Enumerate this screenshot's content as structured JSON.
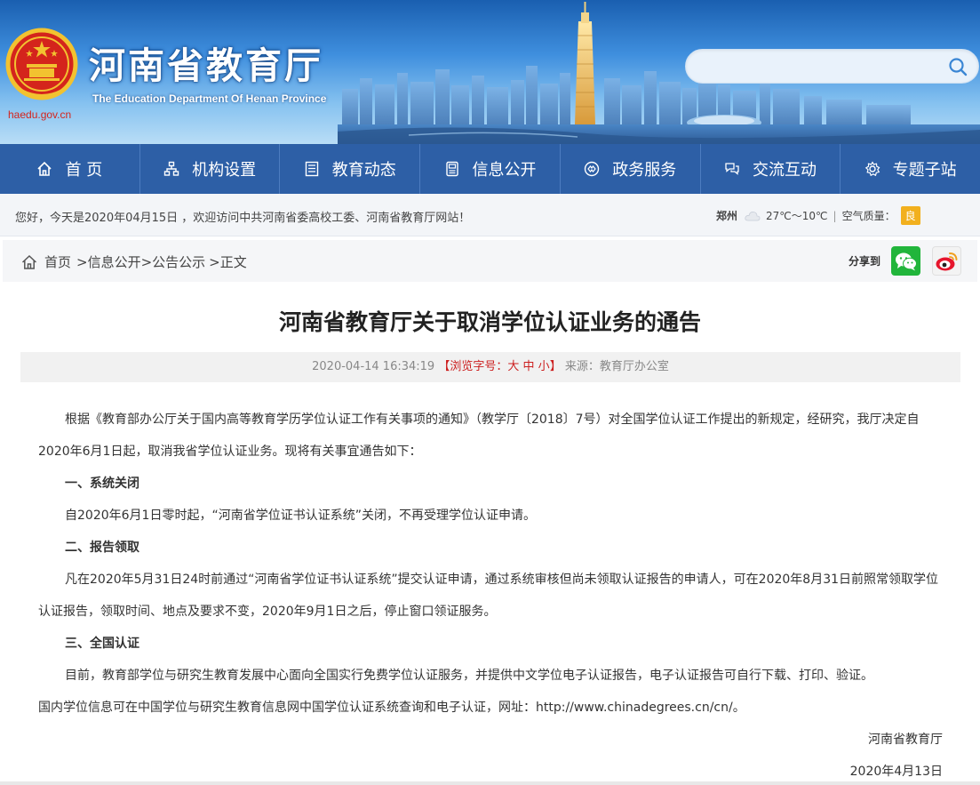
{
  "header": {
    "site_url": "haedu.gov.cn",
    "title_cn": "河南省教育厅",
    "title_en": "The Education Department Of Henan Province",
    "search_placeholder": ""
  },
  "nav": {
    "items": [
      {
        "label": "首 页",
        "icon": "home-icon"
      },
      {
        "label": "机构设置",
        "icon": "org-chart-icon"
      },
      {
        "label": "教育动态",
        "icon": "news-icon"
      },
      {
        "label": "信息公开",
        "icon": "document-icon"
      },
      {
        "label": "政务服务",
        "icon": "service-icon"
      },
      {
        "label": "交流互动",
        "icon": "interaction-icon"
      },
      {
        "label": "专题子站",
        "icon": "gear-icon"
      }
    ]
  },
  "welcome": {
    "text": "您好，今天是2020年04月15日 ，欢迎访问中共河南省委高校工委、河南省教育厅网站！",
    "city": "郑州",
    "temperature": "27℃～10℃",
    "air_quality_label": "空气质量：",
    "air_quality_value": "良",
    "air_quality_color": "#f2b01e"
  },
  "breadcrumb": {
    "home": "首页",
    "level1": ">信息公开",
    "level2": ">公告公示",
    "current": ">正文"
  },
  "share": {
    "label": "分享到"
  },
  "article": {
    "title": "河南省教育厅关于取消学位认证业务的通告",
    "datetime": "2020-04-14 16:34:19",
    "font_size_label": "【浏览字号：",
    "font_large": "大",
    "font_medium": "中",
    "font_small": "小",
    "font_size_close": "】",
    "source": "来源：教育厅办公室",
    "para1": "根据《教育部办公厅关于国内高等教育学历学位认证工作有关事项的通知》（教学厅〔2018〕7号）对全国学位认证工作提出的新规定，经研究，我厅决定自2020年6月1日起，取消我省学位认证业务。现将有关事宜通告如下：",
    "heading1": "一、系统关闭",
    "para2": "自2020年6月1日零时起，“河南省学位证书认证系统”关闭，不再受理学位认证申请。",
    "heading2": "二、报告领取",
    "para3": "凡在2020年5月31日24时前通过“河南省学位证书认证系统”提交认证申请，通过系统审核但尚未领取认证报告的申请人，可在2020年8月31日前照常领取学位认证报告，领取时间、地点及要求不变，2020年9月1日之后，停止窗口领证服务。",
    "heading3": "三、全国认证",
    "para4": "目前，教育部学位与研究生教育发展中心面向全国实行免费学位认证服务，并提供中文学位电子认证报告，电子认证报告可自行下载、打印、验证。",
    "para5": "国内学位信息可在中国学位与研究生教育信息网中国学位认证系统查询和电子认证，网址：http://www.chinadegrees.cn/cn/。",
    "signature": "河南省教育厅",
    "date": "2020年4月13日"
  }
}
